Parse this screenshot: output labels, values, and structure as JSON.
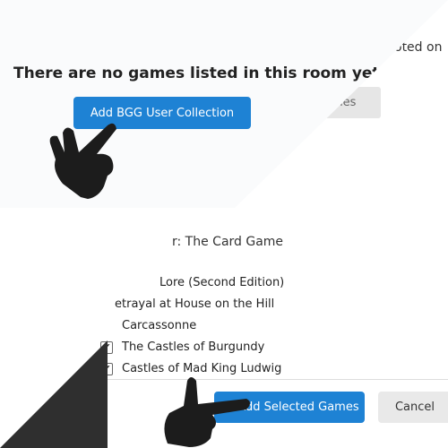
{
  "behind": {
    "voted_text": "oted on",
    "games_button": "mes"
  },
  "top_card": {
    "headline": "There are no games listed in this room yet.",
    "add_bgg_button": "Add BGG User Collection"
  },
  "game_list": {
    "partial_header": "r: The Card Game",
    "items": [
      {
        "label": "Lore (Second Edition)",
        "checked": false
      },
      {
        "label": "etrayal at House on the Hill",
        "checked": false
      },
      {
        "label": "Carcassonne",
        "checked": false
      },
      {
        "label": "The Castles of Burgundy",
        "checked": true
      },
      {
        "label": "Castles of Mad King Ludwig",
        "checked": true
      }
    ]
  },
  "footer": {
    "add_selected_button": "Add Selected Games",
    "cancel_button": "Cancel"
  },
  "colors": {
    "primary": "#1e82d4",
    "cancel": "#e9e9e9"
  },
  "icons": [
    "hand-pointer-icon",
    "checkbox-checked-icon",
    "checkbox-unchecked-icon"
  ]
}
